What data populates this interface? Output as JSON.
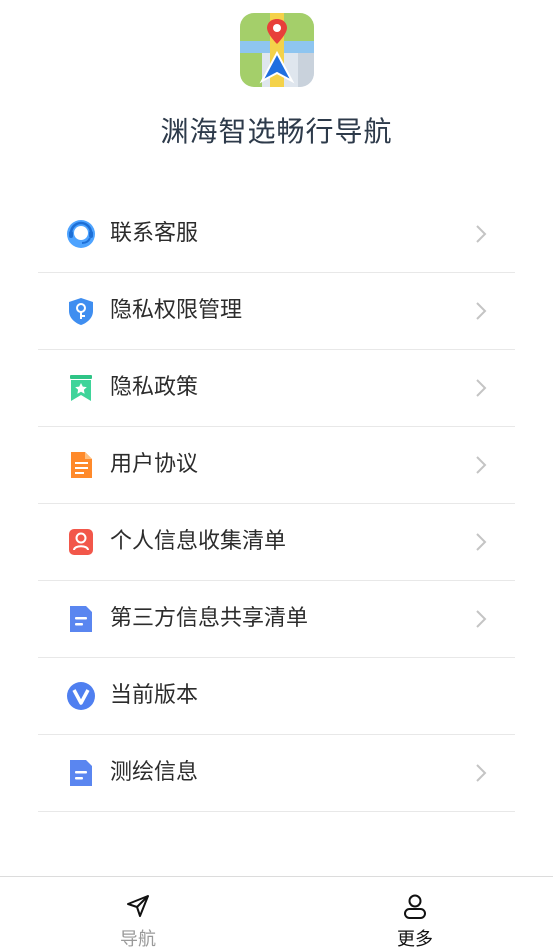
{
  "app": {
    "title": "渊海智选畅行导航"
  },
  "menu": {
    "items": [
      {
        "label": "联系客服",
        "icon": "customer-service-icon",
        "has_chevron": true
      },
      {
        "label": "隐私权限管理",
        "icon": "privacy-shield-icon",
        "has_chevron": true
      },
      {
        "label": "隐私政策",
        "icon": "bookmark-star-icon",
        "has_chevron": true
      },
      {
        "label": "用户协议",
        "icon": "document-icon",
        "has_chevron": true
      },
      {
        "label": "个人信息收集清单",
        "icon": "person-card-icon",
        "has_chevron": true
      },
      {
        "label": "第三方信息共享清单",
        "icon": "file-lines-icon",
        "has_chevron": true
      },
      {
        "label": "当前版本",
        "icon": "version-v-icon",
        "has_chevron": false
      },
      {
        "label": "测绘信息",
        "icon": "file-lines-icon",
        "has_chevron": true
      }
    ]
  },
  "tabbar": {
    "tabs": [
      {
        "label": "导航",
        "icon": "navigation-arrow-icon",
        "active": false
      },
      {
        "label": "更多",
        "icon": "person-icon",
        "active": true
      }
    ]
  },
  "colors": {
    "title": "#2d3a4a",
    "label": "#2c2c2c",
    "divider": "#e8e8e8",
    "chevron": "#c4c4c4",
    "tab_inactive": "#9a9a9a",
    "tab_active": "#111111"
  }
}
